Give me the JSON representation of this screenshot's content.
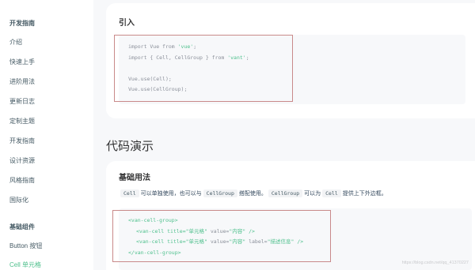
{
  "sidebar": {
    "group1_title": "开发指南",
    "items": [
      "介绍",
      "快速上手",
      "进阶用法",
      "更新日志",
      "定制主题",
      "开发指南",
      "设计资源",
      "风格指南",
      "国际化"
    ],
    "group2_title": "基础组件",
    "group2_items": [
      "Button 按钮",
      "Cell 单元格"
    ]
  },
  "import_card": {
    "title": "引入",
    "code": {
      "l1_kw": "import Vue from ",
      "l1_str": "'vue'",
      "l1_end": ";",
      "l2_kw": "import { Cell, CellGroup } from ",
      "l2_str": "'vant'",
      "l2_end": ";",
      "l3": "",
      "l4": "Vue.use(Cell);",
      "l5": "Vue.use(CellGroup);"
    }
  },
  "section": {
    "title": "代码演示"
  },
  "basic_card": {
    "title": "基础用法",
    "desc": {
      "chip1": "Cell",
      "t1": "可以单独使用，也可以与",
      "chip2": "CellGroup",
      "t2": "搭配使用。",
      "chip3": "CellGroup",
      "t3": "可以为",
      "chip4": "Cell",
      "t4": "提供上下外边框。"
    },
    "code": {
      "l1": "<van-cell-group>",
      "l2_a": "<van-cell title=",
      "l2_b": "\"单元格\"",
      "l2_c": " value=",
      "l2_d": "\"内容\"",
      "l2_e": " />",
      "l3_a": "<van-cell title=",
      "l3_b": "\"单元格\"",
      "l3_c": " value=",
      "l3_d": "\"内容\"",
      "l3_e": " label=",
      "l3_f": "\"描述信息\"",
      "l3_g": " />",
      "l4": "</van-cell-group>"
    }
  },
  "watermark": "https://blog.csdn.net/qq_41370227",
  "colors": {
    "accent": "#4fc08d",
    "highlight_border": "#c98a8a"
  }
}
